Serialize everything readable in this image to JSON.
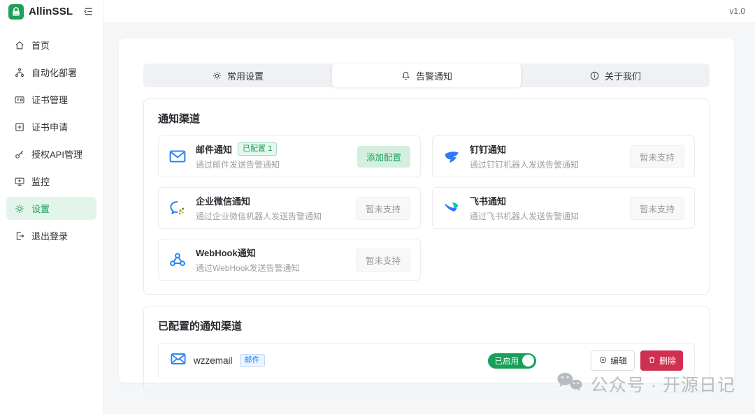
{
  "app": {
    "name": "AllinSSL",
    "version": "v1.0"
  },
  "colors": {
    "brand_green": "#18a058",
    "info_blue": "#2080f0",
    "danger_red": "#d03050"
  },
  "sidebar": {
    "items": [
      {
        "label": "首页",
        "icon": "home-icon",
        "active": false
      },
      {
        "label": "自动化部署",
        "icon": "deploy-icon",
        "active": false
      },
      {
        "label": "证书管理",
        "icon": "cert-manage-icon",
        "active": false
      },
      {
        "label": "证书申请",
        "icon": "cert-apply-icon",
        "active": false
      },
      {
        "label": "授权API管理",
        "icon": "api-auth-icon",
        "active": false
      },
      {
        "label": "监控",
        "icon": "monitor-icon",
        "active": false
      },
      {
        "label": "设置",
        "icon": "settings-icon",
        "active": true
      },
      {
        "label": "退出登录",
        "icon": "logout-icon",
        "active": false
      }
    ]
  },
  "tabs": [
    {
      "label": "常用设置",
      "icon": "gear-icon",
      "active": false
    },
    {
      "label": "告警通知",
      "icon": "bell-icon",
      "active": true
    },
    {
      "label": "关于我们",
      "icon": "info-icon",
      "active": false
    }
  ],
  "channels_section": {
    "title": "通知渠道",
    "channels": [
      {
        "name": "邮件通知",
        "badge": "已配置 1",
        "desc": "通过邮件发送告警通知",
        "action": "添加配置",
        "icon": "email-icon"
      },
      {
        "name": "钉钉通知",
        "desc": "通过钉钉机器人发送告警通知",
        "action": "暂未支持",
        "icon": "dingtalk-icon"
      },
      {
        "name": "企业微信通知",
        "desc": "通过企业微信机器人发送告警通知",
        "action": "暂未支持",
        "icon": "wecom-icon"
      },
      {
        "name": "飞书通知",
        "desc": "通过飞书机器人发送告警通知",
        "action": "暂未支持",
        "icon": "feishu-icon"
      },
      {
        "name": "WebHook通知",
        "desc": "通过WebHook发送告警通知",
        "action": "暂未支持",
        "icon": "webhook-icon"
      }
    ]
  },
  "configured_section": {
    "title": "已配置的通知渠道",
    "rows": [
      {
        "name": "wzzemail",
        "type_badge": "邮件",
        "status": "已启用",
        "edit_label": "编辑",
        "delete_label": "删除"
      }
    ]
  },
  "watermark": {
    "text": "公众号 · 开源日记"
  }
}
